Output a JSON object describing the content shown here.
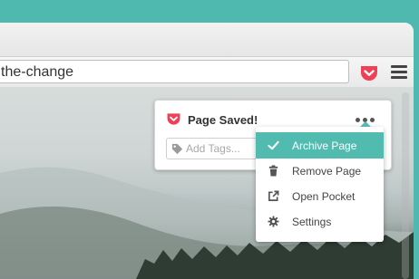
{
  "browser": {
    "url": "the-change",
    "colors": {
      "accent": "#51bbb0",
      "pocket": "#ef4056",
      "frame": "#4fb9af"
    }
  },
  "toolbar": {
    "pocket_icon": "pocket-icon",
    "menu_icon": "hamburger-menu-icon"
  },
  "panel": {
    "title": "Page Saved!",
    "logo_icon": "pocket-icon",
    "more_icon": "more-dots-icon",
    "tags_placeholder": "Add Tags...",
    "tags_icon": "tag-icon"
  },
  "menu": {
    "items": [
      {
        "label": "Archive Page",
        "icon": "checkmark-icon",
        "active": true
      },
      {
        "label": "Remove Page",
        "icon": "trash-icon",
        "active": false
      },
      {
        "label": "Open Pocket",
        "icon": "external-link-icon",
        "active": false
      },
      {
        "label": "Settings",
        "icon": "gear-icon",
        "active": false
      }
    ]
  }
}
